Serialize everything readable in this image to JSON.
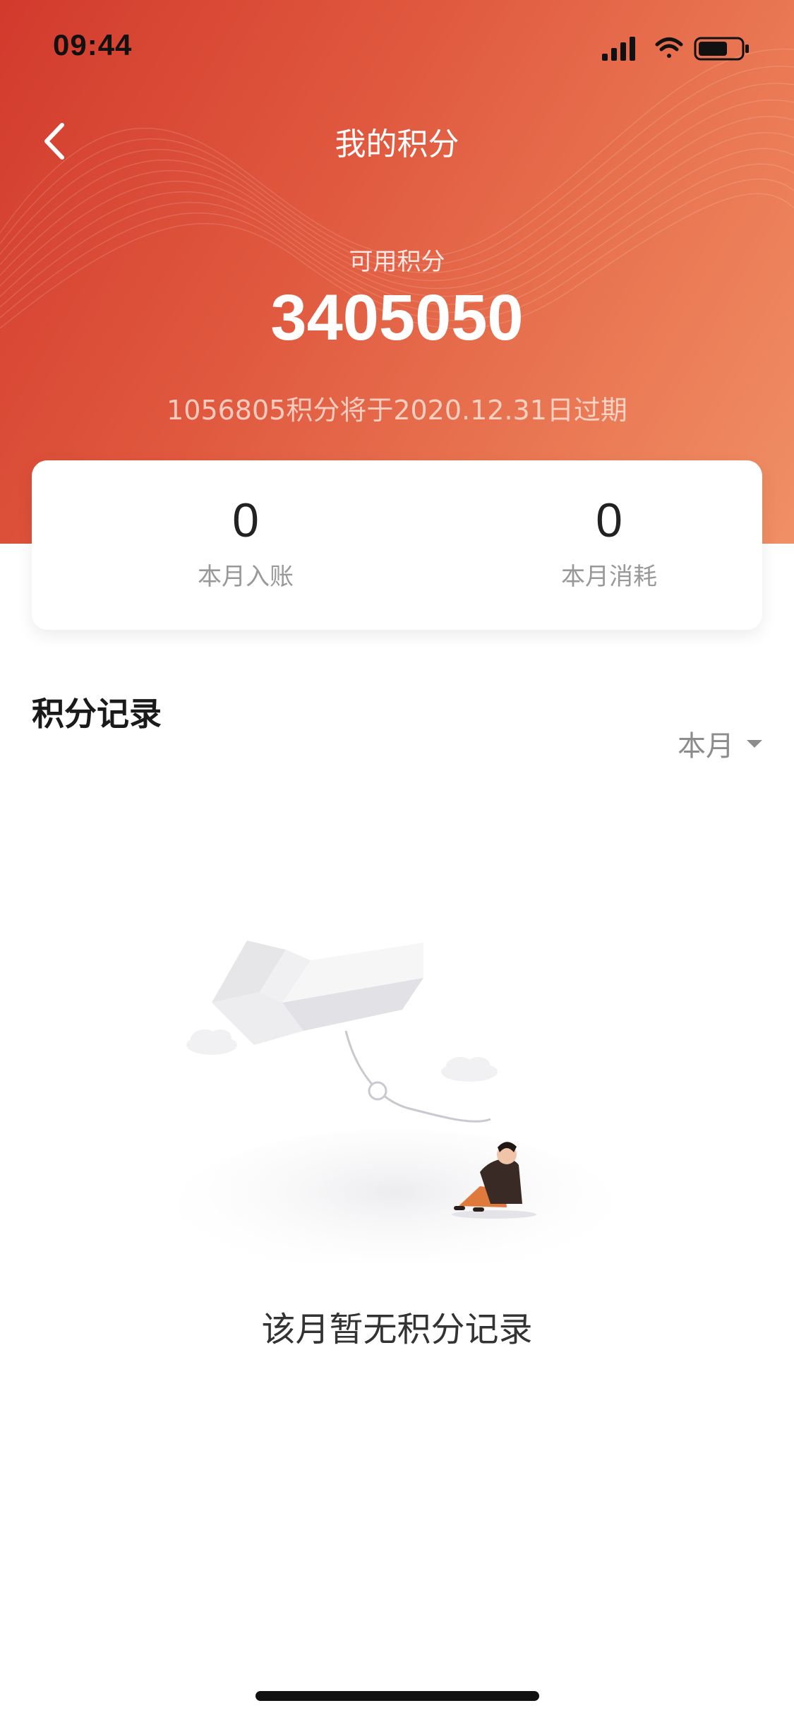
{
  "status_bar": {
    "time": "09:44",
    "icons": [
      "signal-icon",
      "wifi-icon",
      "battery-icon"
    ]
  },
  "nav": {
    "title": "我的积分",
    "back_icon": "chevron-left-icon"
  },
  "points": {
    "available_label": "可用积分",
    "available_value": "3405050",
    "expire_note": "1056805积分将于2020.12.31日过期"
  },
  "stats": {
    "income": {
      "value": "0",
      "label": "本月入账"
    },
    "consume": {
      "value": "0",
      "label": "本月消耗"
    }
  },
  "records": {
    "title": "积分记录",
    "filter_label": "本月",
    "filter_icon": "caret-down-icon",
    "empty_text": "该月暂无积分记录",
    "empty_illustration": "empty-kite-illustration"
  },
  "colors": {
    "header_start": "#d23a2c",
    "header_end": "#f08f66",
    "accent": "#e0593f"
  }
}
